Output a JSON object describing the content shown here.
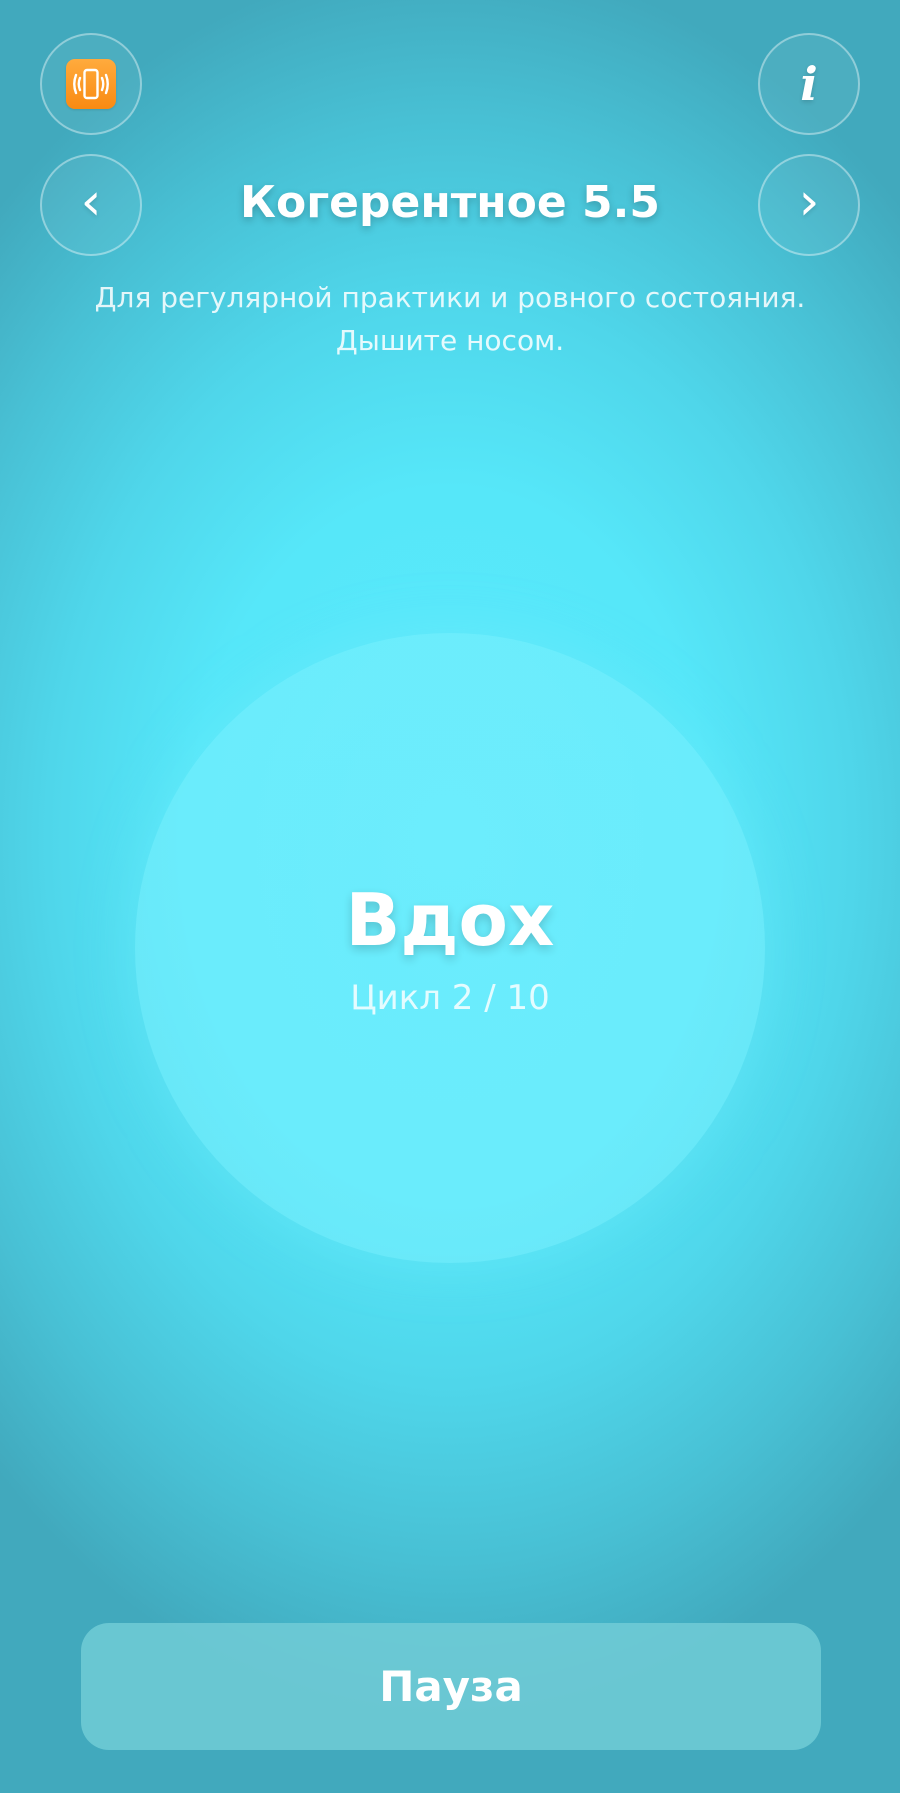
{
  "header": {
    "vibration_icon": "phone-vibrate-icon",
    "info_label": "i",
    "prev_label": "‹",
    "next_label": "›"
  },
  "exercise": {
    "title": "Когерентное 5.5",
    "description_line1": "Для регулярной практики и ровного состояния.",
    "description_line2": "Дышите носом."
  },
  "session": {
    "phase": "Вдох",
    "cycle": "Цикл 2 / 10"
  },
  "controls": {
    "pause_label": "Пауза"
  },
  "colors": {
    "background_center": "#5ce9fb",
    "background_edge": "#41a9bd",
    "vibration_accent": "#f98a12"
  }
}
